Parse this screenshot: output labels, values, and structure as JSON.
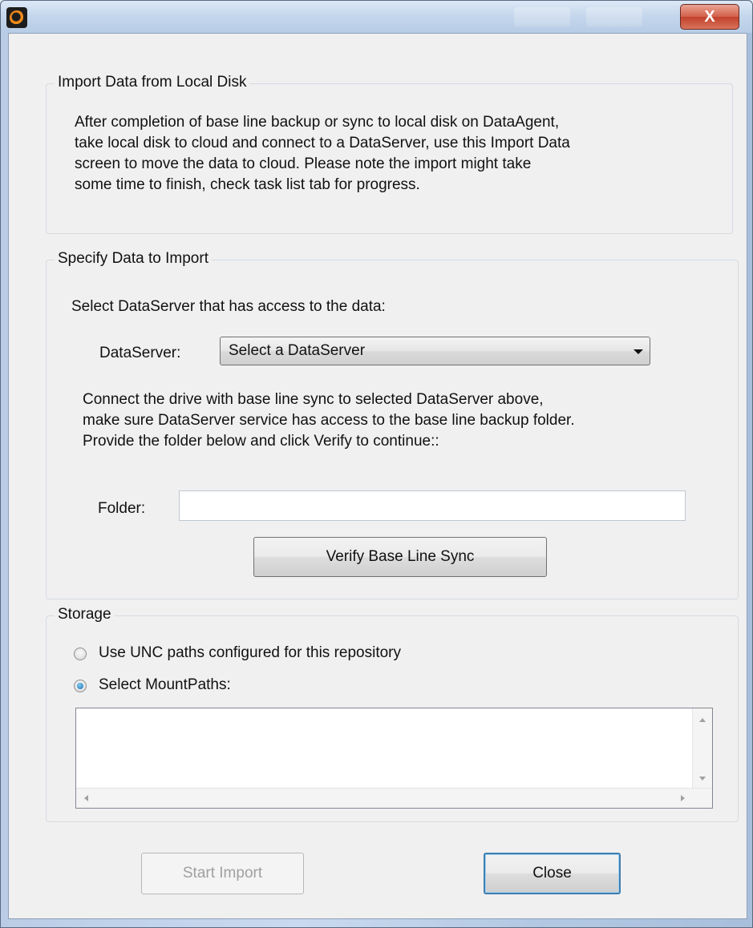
{
  "window": {
    "close_glyph": "X"
  },
  "import_group": {
    "legend": "Import Data from Local Disk",
    "description_lines": [
      "After completion of base line backup or sync to local disk on DataAgent,",
      "take local disk to cloud and connect to a DataServer, use this Import Data",
      "screen to move the data to cloud. Please note the import might take",
      "some time to finish, check task list tab for progress."
    ]
  },
  "specify_group": {
    "legend": "Specify Data to Import",
    "select_prompt": "Select DataServer that has access to the data:",
    "dataserver_label": "DataServer:",
    "dataserver_value": "Select a DataServer",
    "instructions_lines": [
      "Connect the drive with base line sync to selected DataServer above,",
      "make sure DataServer service has access to the base line backup folder.",
      "Provide the folder below and click Verify to continue::"
    ],
    "folder_label": "Folder:",
    "folder_value": "",
    "verify_button": "Verify Base Line Sync"
  },
  "storage_group": {
    "legend": "Storage",
    "option_unc": "Use UNC paths configured for this repository",
    "option_mount": "Select MountPaths:",
    "selected_option": "Select MountPaths:"
  },
  "footer": {
    "start_import": "Start Import",
    "close": "Close"
  }
}
